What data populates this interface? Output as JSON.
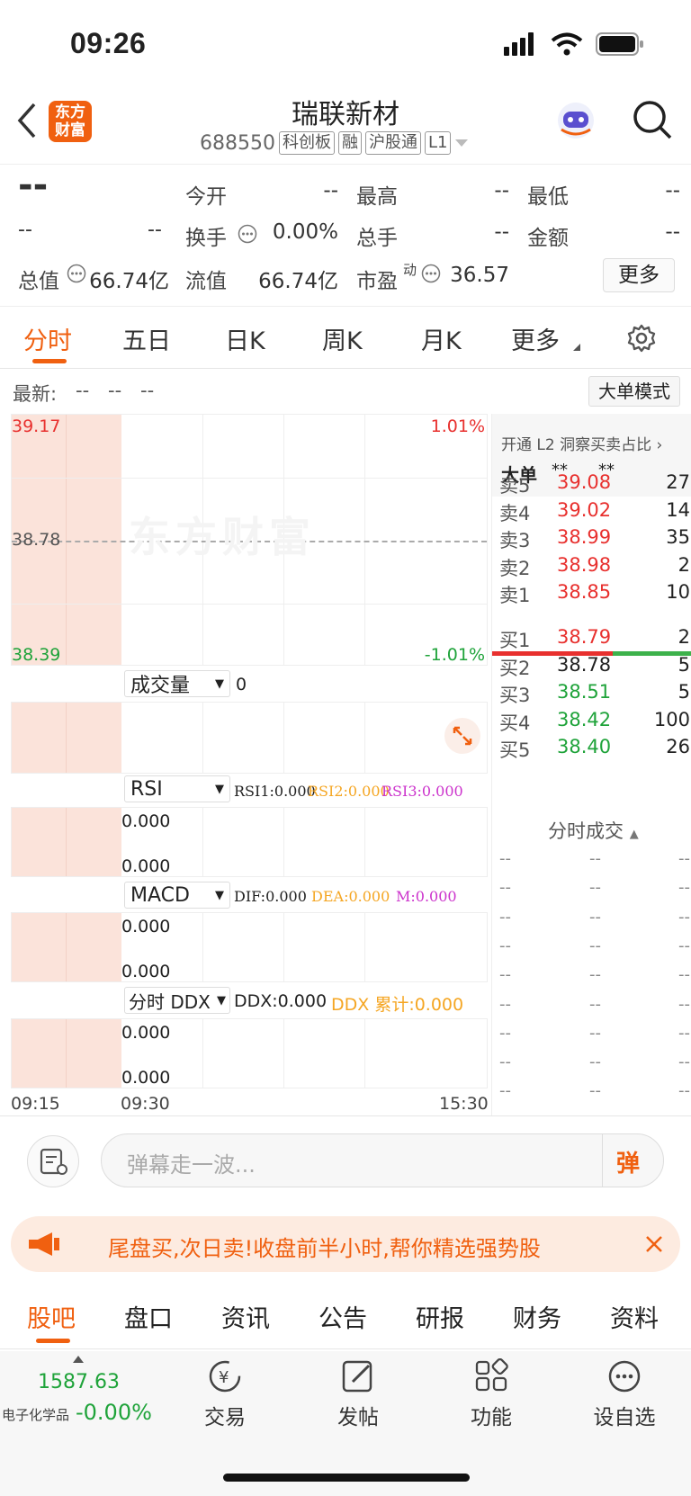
{
  "status_bar": {
    "time": "09:26"
  },
  "header": {
    "stock_name": "瑞联新材",
    "code": "688550",
    "tags": [
      "科创板",
      "融",
      "沪股通",
      "L1"
    ],
    "brand_line1": "东方",
    "brand_line2": "财富"
  },
  "quote": {
    "price": "--",
    "change": "--",
    "change_pct": "--",
    "open_label": "今开",
    "open": "--",
    "high_label": "最高",
    "high": "--",
    "low_label": "最低",
    "low": "--",
    "turnover_label": "换手",
    "turnover": "0.00%",
    "total_hand_label": "总手",
    "total_hand": "--",
    "amount_label": "金额",
    "amount": "--",
    "mktcap_label": "总值",
    "mktcap": "66.74亿",
    "float_label": "流值",
    "float": "66.74亿",
    "pe_label": "市盈",
    "pe_sup": "动",
    "pe": "36.57",
    "more_button": "更多"
  },
  "chart_tabs": [
    "分时",
    "五日",
    "日K",
    "周K",
    "月K",
    "更多"
  ],
  "latest": {
    "label": "最新:",
    "v1": "--",
    "v2": "--",
    "v3": "--"
  },
  "big_order_button": "大单模式",
  "price_axis": {
    "top": "39.17",
    "mid": "38.78",
    "bottom": "38.39",
    "pct_top": "1.01%",
    "pct_bottom": "-1.01%"
  },
  "watermark": "东方财富",
  "volume": {
    "selector": "成交量",
    "value": "0"
  },
  "rsi": {
    "selector": "RSI",
    "rsi1": "RSI1:0.000",
    "rsi2": "RSI2:0.000",
    "rsi3": "RSI3:0.000",
    "top": "0.000",
    "bottom": "0.000"
  },
  "macd": {
    "selector": "MACD",
    "dif": "DIF:0.000",
    "dea": "DEA:0.000",
    "m": "M:0.000",
    "top": "0.000",
    "bottom": "0.000"
  },
  "ddx": {
    "selector": "分时 DDX",
    "ddx": "DDX:0.000",
    "ddx_cum": "DDX 累计:0.000",
    "top": "0.000",
    "bottom": "0.000"
  },
  "time_axis": {
    "t1": "09:15",
    "t2": "09:30",
    "t3": "15:30"
  },
  "order_book": {
    "promo": "开通 L2 洞察买卖占比",
    "big_order_label": "大单",
    "big_v1": "**",
    "big_v2": "**",
    "asks": [
      {
        "label": "卖5",
        "price": "39.08",
        "vol": "27",
        "color": "red"
      },
      {
        "label": "卖4",
        "price": "39.02",
        "vol": "14",
        "color": "red"
      },
      {
        "label": "卖3",
        "price": "38.99",
        "vol": "35",
        "color": "red"
      },
      {
        "label": "卖2",
        "price": "38.98",
        "vol": "2",
        "color": "red"
      },
      {
        "label": "卖1",
        "price": "38.85",
        "vol": "10",
        "color": "red"
      }
    ],
    "bids": [
      {
        "label": "买1",
        "price": "38.79",
        "vol": "2",
        "color": "red"
      },
      {
        "label": "买2",
        "price": "38.78",
        "vol": "5",
        "color": "black"
      },
      {
        "label": "买3",
        "price": "38.51",
        "vol": "5",
        "color": "green"
      },
      {
        "label": "买4",
        "price": "38.42",
        "vol": "100",
        "color": "green"
      },
      {
        "label": "买5",
        "price": "38.40",
        "vol": "26",
        "color": "green"
      }
    ],
    "ticks_label": "分时成交",
    "ticks": [
      "--",
      "--",
      "--",
      "--",
      "--",
      "--",
      "--",
      "--",
      "--"
    ]
  },
  "comment": {
    "placeholder": "弹幕走一波...",
    "danmu_icon": "弹"
  },
  "banner": {
    "text": "尾盘买,次日卖!收盘前半小时,帮你精选强势股"
  },
  "section_tabs": [
    "股吧",
    "盘口",
    "资讯",
    "公告",
    "研报",
    "财务",
    "资料"
  ],
  "bottom_nav": {
    "index_value": "1587.63",
    "index_name": "电子化学品",
    "index_change": "-0.00%",
    "items": [
      "交易",
      "发帖",
      "功能",
      "设自选"
    ]
  },
  "colors": {
    "brand_orange": "#f06010",
    "up_red": "#e8302e",
    "down_green": "#1fa33a"
  }
}
